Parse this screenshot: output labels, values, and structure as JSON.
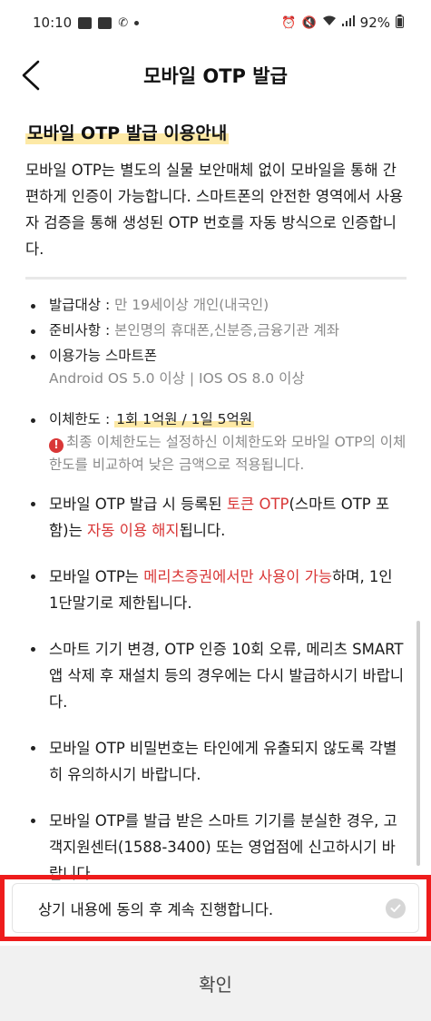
{
  "status_bar": {
    "time": "10:10",
    "battery": "92%"
  },
  "header": {
    "title": "모바일 OTP 발급"
  },
  "guide": {
    "title": "모바일 OTP 발급 이용안내",
    "intro": "모바일 OTP는 별도의 실물 보안매체 없이 모바일을 통해 간편하게 인증이 가능합니다. 스마트폰의 안전한 영역에서 사용자 검증을 통해 생성된 OTP 번호를 자동 방식으로 인증합니다."
  },
  "info": {
    "target_label": "발급대상 : ",
    "target_value": "만 19세이상 개인(내국인)",
    "prep_label": "준비사항 : ",
    "prep_value": "본인명의 휴대폰,신분증,금융기관 계좌",
    "device_label": "이용가능 스마트폰",
    "device_value": "Android OS 5.0 이상 | IOS OS 8.0 이상",
    "limit_label": "이체한도 : ",
    "limit_value": "1회 1억원 / 1일 5억원",
    "limit_warning": "최종 이체한도는 설정하신 이체한도와 모바일 OTP의 이체한도를 비교하여 낮은 금액으로 적용됩니다."
  },
  "notes": {
    "n1_a": "모바일 OTP 발급 시 등록된 ",
    "n1_b": "토큰 OTP",
    "n1_c": "(스마트 OTP 포함)는 ",
    "n1_d": "자동 이용 해지",
    "n1_e": "됩니다.",
    "n2_a": "모바일 OTP는 ",
    "n2_b": "메리츠증권에서만 사용이 가능",
    "n2_c": "하며, 1인 1단말기로 제한됩니다.",
    "n3": "스마트 기기 변경, OTP 인증 10회 오류, 메리츠 SMART 앱 삭제 후 재설치 등의 경우에는 다시 발급하시기 바랍니다.",
    "n4": "모바일 OTP 비밀번호는 타인에게 유출되지 않도록 각별히 유의하시기 바랍니다.",
    "n5": "모바일 OTP를 발급 받은 스마트 기기를 분실한 경우, 고객지원센터(1588-3400) 또는 영업점에 신고하시기 바랍니다."
  },
  "agree": {
    "label": "상기 내용에 동의 후 계속 진행합니다.",
    "checked": false
  },
  "confirm": {
    "label": "확인"
  },
  "colors": {
    "highlight": "#fde9a6",
    "accent_red": "#d93737",
    "focus_border": "#ee1c1c"
  }
}
